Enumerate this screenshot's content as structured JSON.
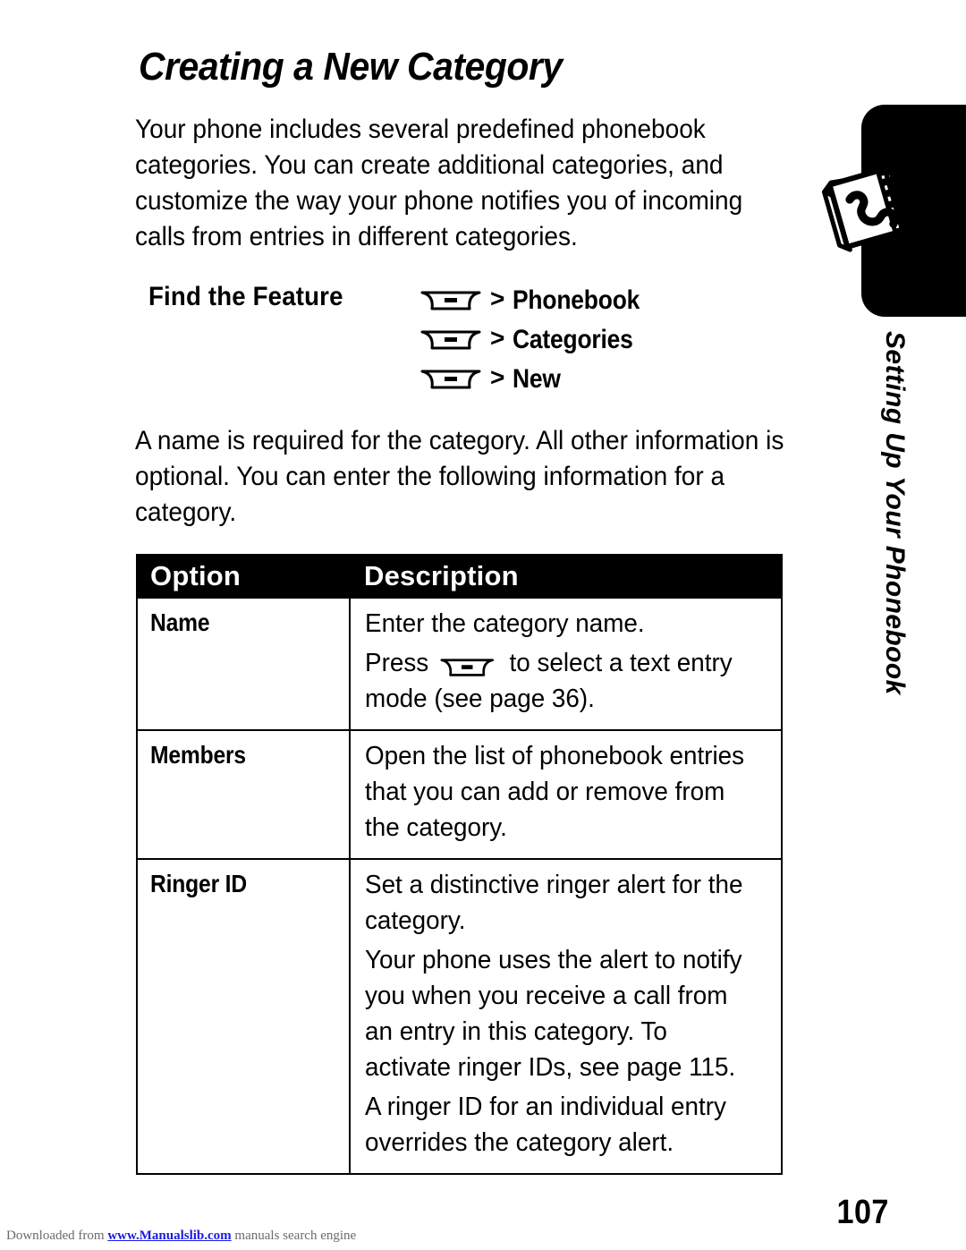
{
  "document": {
    "title": "Creating a New Category",
    "page_number": "107"
  },
  "intro_paragraph": "Your phone includes several predefined phonebook categories. You can create additional categories, and customize the way your phone notifies you of incoming calls from entries in different categories.",
  "find_the_feature": {
    "label": "Find the Feature",
    "separator": ">",
    "icon": "menu-key-icon",
    "steps": [
      {
        "key_icon": "menu-key-icon",
        "separator": ">",
        "name": "Phonebook"
      },
      {
        "key_icon": "menu-key-icon",
        "separator": ">",
        "name": "Categories"
      },
      {
        "key_icon": "menu-key-icon",
        "separator": ">",
        "name": "New"
      }
    ]
  },
  "second_paragraph": "A name is required for the category. All other information is optional. You can enter the following information for a category.",
  "options_table": {
    "headers": {
      "option": "Option",
      "description": "Description"
    },
    "rows": [
      {
        "option": "Name",
        "paragraphs": [
          {
            "text": "Enter the category name."
          },
          {
            "prefix": "Press ",
            "icon": "menu-key-icon",
            "suffix": " to select a text entry mode (see page 36)."
          }
        ]
      },
      {
        "option": "Members",
        "paragraphs": [
          {
            "text": "Open the list of phonebook entries that you can add or remove from the category."
          }
        ]
      },
      {
        "option": "Ringer ID",
        "paragraphs": [
          {
            "text": "Set a distinctive ringer alert for the category."
          },
          {
            "text": "Your phone uses the alert to notify you when you receive a call from an entry in this category. To activate ringer IDs, see page 115."
          },
          {
            "text": "A ringer ID for an individual entry overrides the category alert."
          }
        ]
      }
    ]
  },
  "chapter_tab": {
    "label": "Setting Up Your Phonebook",
    "icon": "phonebook-book-icon",
    "color": "#000000"
  },
  "footer": {
    "watermark_prefix": "Downloaded from ",
    "watermark_link": "www.Manualslib.com",
    "watermark_suffix": " manuals search engine",
    "link_color": "#1a1ae6"
  }
}
